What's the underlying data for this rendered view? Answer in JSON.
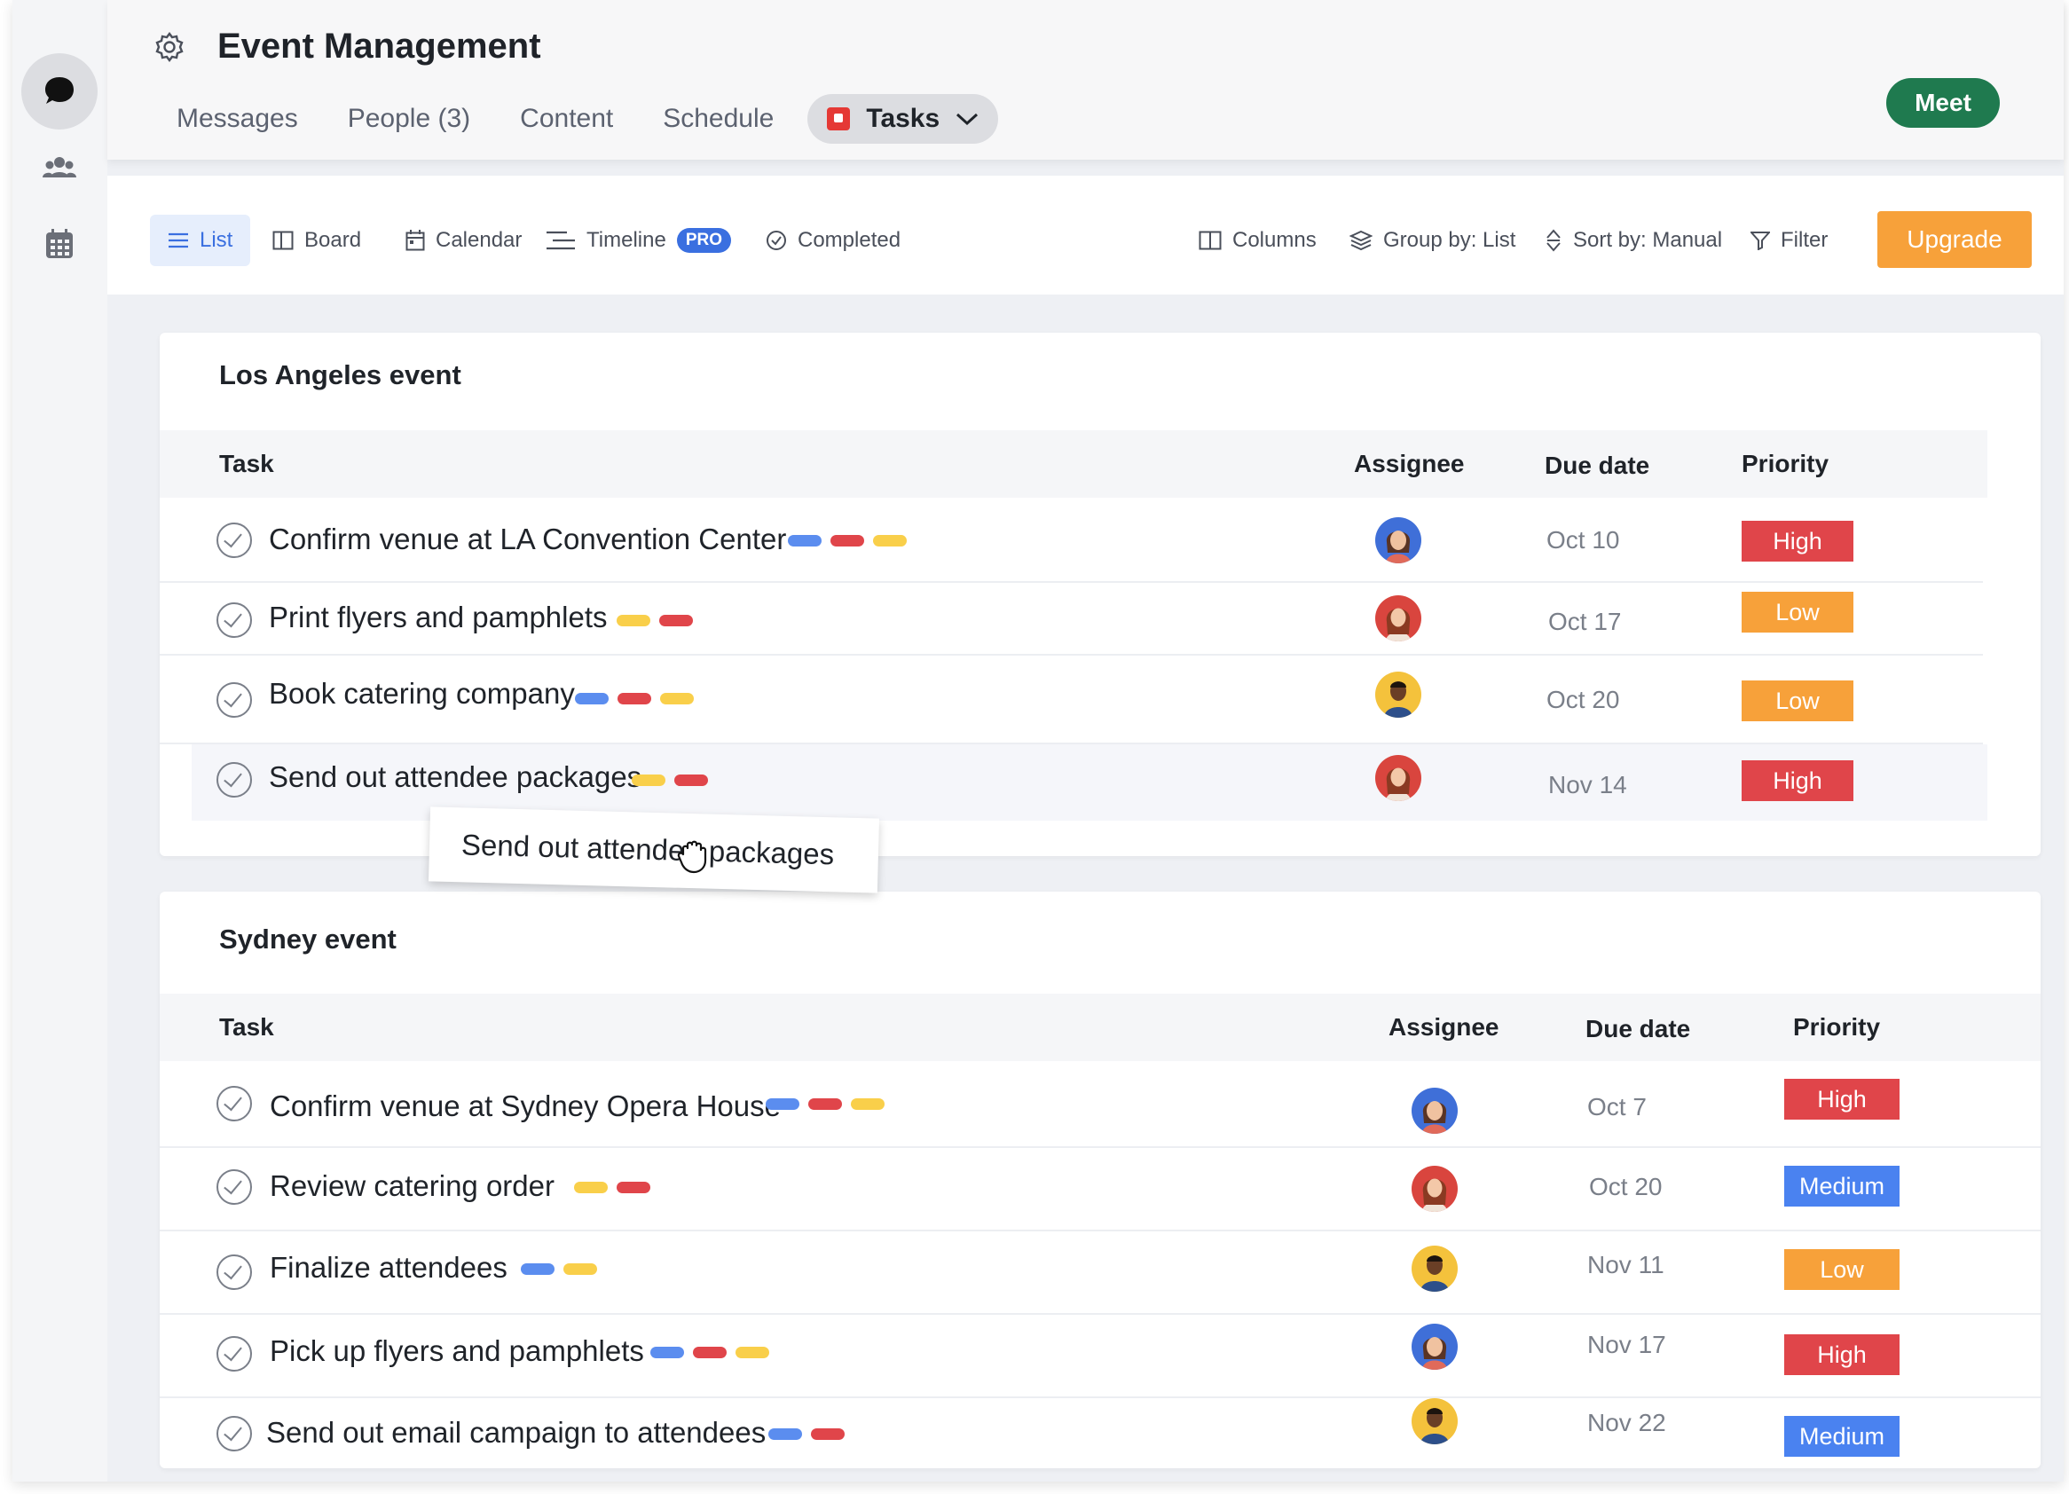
{
  "header": {
    "title": "Event Management",
    "tabs": [
      {
        "label": "Messages"
      },
      {
        "label": "People (3)"
      },
      {
        "label": "Content"
      },
      {
        "label": "Schedule"
      },
      {
        "label": "Tasks",
        "active": true
      }
    ],
    "meet_label": "Meet"
  },
  "sidebar": {
    "items": [
      {
        "icon": "chat-bubble-icon",
        "active": true
      },
      {
        "icon": "people-icon"
      },
      {
        "icon": "calendar-grid-icon"
      }
    ]
  },
  "toolbar": {
    "views": [
      {
        "label": "List",
        "icon": "list-icon",
        "active": true
      },
      {
        "label": "Board",
        "icon": "board-icon"
      },
      {
        "label": "Calendar",
        "icon": "calendar-icon"
      },
      {
        "label": "Timeline",
        "icon": "timeline-icon",
        "badge": "PRO"
      },
      {
        "label": "Completed",
        "icon": "check-circle-icon"
      }
    ],
    "actions": [
      {
        "label": "Columns",
        "icon": "columns-icon"
      },
      {
        "label": "Group by: List",
        "icon": "layers-icon"
      },
      {
        "label": "Sort by: Manual",
        "icon": "sort-icon"
      },
      {
        "label": "Filter",
        "icon": "filter-icon"
      }
    ],
    "upgrade_label": "Upgrade"
  },
  "columns": {
    "task": "Task",
    "assignee": "Assignee",
    "due": "Due date",
    "priority": "Priority"
  },
  "groups": [
    {
      "title": "Los Angeles event",
      "tasks": [
        {
          "name": "Confirm venue at LA Convention Center",
          "tags": [
            "blue",
            "red",
            "yellow"
          ],
          "assignee": "woman-brown-hair",
          "due": "Oct 10",
          "priority": "High"
        },
        {
          "name": "Print flyers and pamphlets",
          "tags": [
            "yellow",
            "red"
          ],
          "assignee": "woman-red-hair",
          "due": "Oct 17",
          "priority": "Low"
        },
        {
          "name": "Book catering company",
          "tags": [
            "blue",
            "red",
            "yellow"
          ],
          "assignee": "man-dark-skin",
          "due": "Oct 20",
          "priority": "Low"
        },
        {
          "name": "Send out attendee packages",
          "tags": [
            "yellow",
            "red"
          ],
          "assignee": "woman-red-hair",
          "due": "Nov 14",
          "priority": "High"
        }
      ]
    },
    {
      "title": "Sydney event",
      "tasks": [
        {
          "name": "Confirm venue at Sydney Opera House",
          "tags": [
            "blue",
            "red",
            "yellow"
          ],
          "assignee": "woman-brown-hair",
          "due": "Oct 7",
          "priority": "High"
        },
        {
          "name": "Review catering order",
          "tags": [
            "yellow",
            "red"
          ],
          "assignee": "woman-red-hair",
          "due": "Oct 20",
          "priority": "Medium"
        },
        {
          "name": "Finalize attendees",
          "tags": [
            "blue",
            "yellow"
          ],
          "assignee": "man-dark-skin",
          "due": "Nov 11",
          "priority": "Low"
        },
        {
          "name": "Pick up flyers and pamphlets",
          "tags": [
            "blue",
            "red",
            "yellow"
          ],
          "assignee": "woman-brown-hair",
          "due": "Nov 17",
          "priority": "High"
        },
        {
          "name": "Send out email campaign to attendees",
          "tags": [
            "blue",
            "red"
          ],
          "assignee": "man-dark-skin",
          "due": "Nov 22",
          "priority": "Medium"
        }
      ]
    }
  ],
  "drag_ghost": {
    "label": "Send out attendee packages"
  },
  "colors": {
    "high": "#e0454a",
    "low": "#f7a13a",
    "medium": "#4a82f0",
    "tag_blue": "#5b8def",
    "tag_red": "#e0454a",
    "tag_yellow": "#f9cf4a",
    "meet": "#1f7a4f",
    "upgrade": "#f7a13a",
    "accent": "#3a6fe0"
  }
}
